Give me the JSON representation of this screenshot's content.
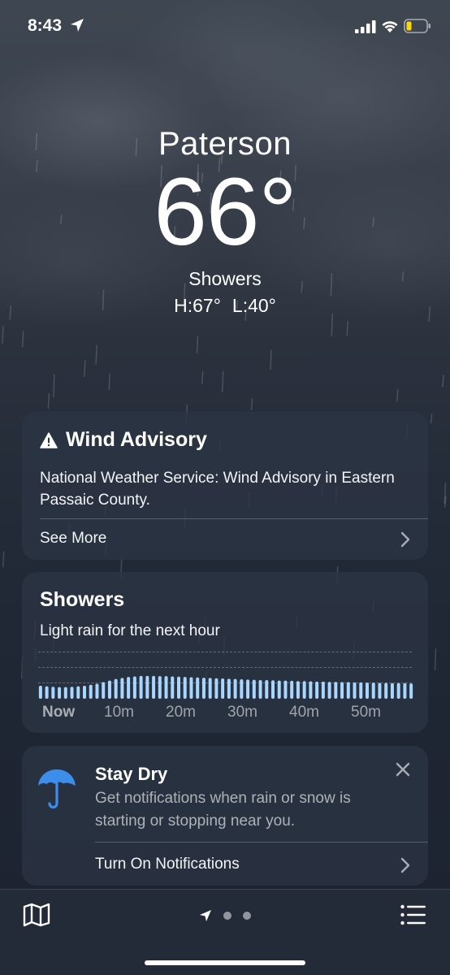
{
  "status_bar": {
    "time": "8:43",
    "icons": [
      "location-arrow-icon",
      "cellular-signal-icon",
      "wifi-icon",
      "battery-low-icon"
    ]
  },
  "current": {
    "city": "Paterson",
    "temperature": "66°",
    "condition": "Showers",
    "high": "H:67°",
    "low": "L:40°"
  },
  "advisory": {
    "title": "Wind Advisory",
    "icon": "warning-triangle-icon",
    "body": "National Weather Service: Wind Advisory in Eastern Passaic County.",
    "see_more": "See More"
  },
  "precipitation": {
    "title": "Showers",
    "subtitle": "Light rain for the next hour",
    "tick_labels": [
      "Now",
      "10m",
      "20m",
      "30m",
      "40m",
      "50m"
    ],
    "bar_color": "#a9d6ff",
    "intensity": [
      0.5,
      0.48,
      0.46,
      0.45,
      0.45,
      0.46,
      0.48,
      0.5,
      0.54,
      0.58,
      0.64,
      0.7,
      0.76,
      0.8,
      0.84,
      0.86,
      0.88,
      0.88,
      0.88,
      0.87,
      0.87,
      0.86,
      0.85,
      0.84,
      0.83,
      0.82,
      0.81,
      0.8,
      0.79,
      0.78,
      0.77,
      0.76,
      0.75,
      0.74,
      0.73,
      0.72,
      0.72,
      0.71,
      0.7,
      0.7,
      0.69,
      0.68,
      0.68,
      0.67,
      0.66,
      0.66,
      0.65,
      0.65,
      0.64,
      0.64,
      0.63,
      0.63,
      0.62,
      0.62,
      0.61,
      0.61,
      0.6,
      0.6,
      0.6,
      0.59
    ]
  },
  "stay_dry": {
    "title": "Stay Dry",
    "body": "Get notifications when rain or snow is starting or stopping near you.",
    "action": "Turn On Notifications",
    "icon": "umbrella-icon",
    "icon_color": "#3d8eea"
  },
  "toolbar": {
    "icons": [
      "map-icon",
      "location-arrow-icon",
      "list-icon"
    ],
    "page_count": 3
  }
}
